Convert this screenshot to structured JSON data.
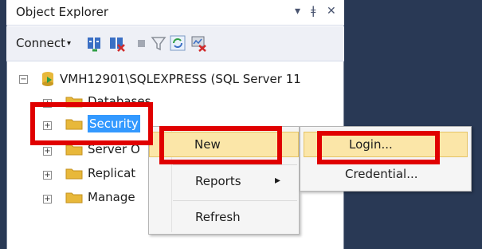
{
  "window": {
    "title": "Object Explorer",
    "controls": {
      "dropdown": "▾",
      "pin": "ǂ",
      "close": "✕"
    }
  },
  "toolbar": {
    "connect_label": "Connect",
    "connect_caret": "▾",
    "icons": [
      "connect-object-explorer-icon",
      "disconnect-icon",
      "stop-icon",
      "filter-icon",
      "refresh-icon",
      "activity-monitor-icon"
    ]
  },
  "tree": {
    "root": {
      "label": "VMH12901\\SQLEXPRESS (SQL Server 11",
      "expander": "−"
    },
    "nodes": [
      {
        "label": "Databases",
        "expander": "+",
        "selected": false
      },
      {
        "label": "Security",
        "expander": "+",
        "selected": true
      },
      {
        "label": "Server O",
        "expander": "+",
        "selected": false
      },
      {
        "label": "Replicat",
        "expander": "+",
        "selected": false
      },
      {
        "label": "Manage",
        "expander": "+",
        "selected": false
      }
    ]
  },
  "context_menu": {
    "items": [
      {
        "label": "New",
        "highlighted": true,
        "has_submenu": true
      },
      {
        "label": "Reports",
        "highlighted": false,
        "has_submenu": true,
        "arrow": "▸"
      },
      {
        "label": "Refresh",
        "highlighted": false,
        "has_submenu": false
      }
    ]
  },
  "submenu": {
    "items": [
      {
        "label": "Login...",
        "highlighted": true
      },
      {
        "label": "Credential...",
        "highlighted": false
      }
    ]
  },
  "colors": {
    "dark_background": "#293955",
    "selection": "#3399ff",
    "menu_highlight": "#fbe6a8",
    "annotation_red": "#e00000",
    "folder_yellow": "#e8b83a"
  }
}
